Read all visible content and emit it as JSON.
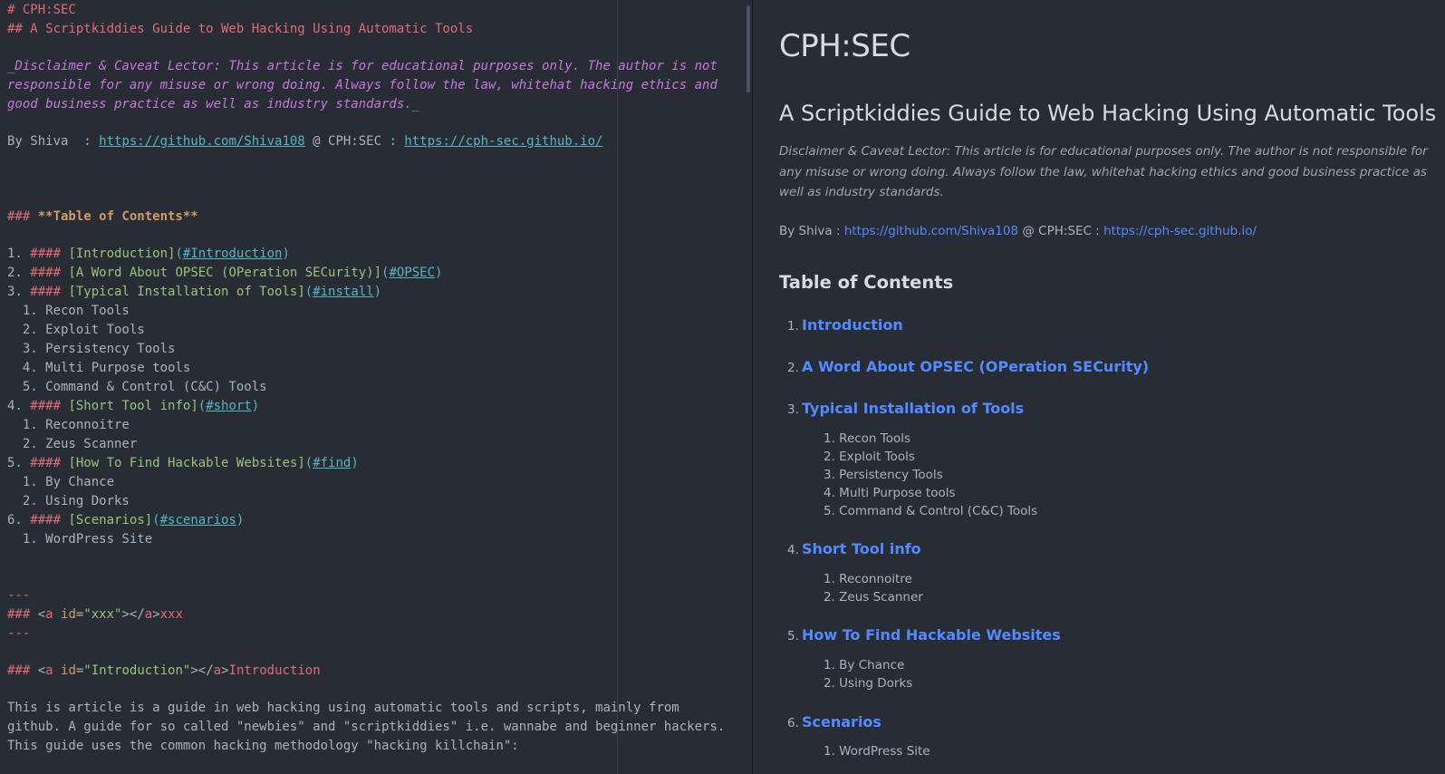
{
  "editor": {
    "h1": "# CPH:SEC",
    "h2": "## A Scriptkiddies Guide to Web Hacking Using Automatic Tools",
    "disclaimer_lines": [
      "_Disclaimer & Caveat Lector: This article is for educational purposes only. The author is not",
      "responsible for any misuse or wrong doing. Always follow the law, whitehat hacking ethics and",
      "good business practice as well as industry standards._"
    ],
    "by_prefix": "By Shiva  : ",
    "github_url": "https://github.com/Shiva108",
    "by_middle": " @ CPH:SEC : ",
    "site_url": "https://cph-sec.github.io/",
    "toc_hash": "### ",
    "toc_title": "**Table of Contents**",
    "toc": [
      {
        "num": "1. ",
        "hash": "####",
        "text": "[Introduction]",
        "anchor": "#Introduction"
      },
      {
        "num": "2. ",
        "hash": "####",
        "text": "[A Word About OPSEC (OPeration SECurity)]",
        "anchor": "#OPSEC"
      },
      {
        "num": "3. ",
        "hash": "####",
        "text": "[Typical Installation of Tools]",
        "anchor": "#install"
      },
      {
        "num": "4. ",
        "hash": "####",
        "text": "[Short Tool info]",
        "anchor": "#short"
      },
      {
        "num": "5. ",
        "hash": "####",
        "text": "[How To Find Hackable Websites]",
        "anchor": "#find"
      },
      {
        "num": "6. ",
        "hash": "####",
        "text": "[Scenarios]",
        "anchor": "#scenarios"
      }
    ],
    "sub_install": [
      "  1. Recon Tools",
      "  2. Exploit Tools",
      "  3. Persistency Tools",
      "  4. Multi Purpose tools",
      "  5. Command & Control (C&C) Tools"
    ],
    "sub_short": [
      "  1. Reconnoitre",
      "  2. Zeus Scanner"
    ],
    "sub_find": [
      "  1. By Chance",
      "  2. Using Dorks"
    ],
    "sub_scen": [
      "  1. WordPress Site"
    ],
    "hr": "---",
    "anchor1_hash": "### ",
    "anchor1_tag_open": "<",
    "anchor1_tag_name": "a",
    "anchor1_attr": " id",
    "anchor1_eq": "=",
    "anchor1_val": "\"xxx\"",
    "anchor1_close": "></",
    "anchor1_tag_name2": "a",
    "anchor1_end": ">",
    "anchor1_text": "xxx",
    "anchor2_val": "\"Introduction\"",
    "anchor2_text": "Introduction",
    "intro_lines": [
      "This is article is a guide in web hacking using automatic tools and scripts, mainly from",
      "github. A guide for so called \"newbies\" and \"scriptkiddies\" i.e. wannabe and beginner hackers.",
      "This guide uses the common hacking methodology \"hacking killchain\":"
    ]
  },
  "preview": {
    "h1": "CPH:SEC",
    "h2": "A Scriptkiddies Guide to Web Hacking Using Automatic Tools",
    "disclaimer": "Disclaimer & Caveat Lector: This article is for educational purposes only. The author is not responsible for any misuse or wrong doing. Always follow the law, whitehat hacking ethics and good business practice as well as industry standards.",
    "by_prefix": "By Shiva : ",
    "github_url": "https://github.com/Shiva108",
    "by_middle": " @ CPH:SEC : ",
    "site_url": "https://cph-sec.github.io/",
    "toc_title": "Table of Contents",
    "toc": [
      {
        "num": "1.",
        "label": "Introduction"
      },
      {
        "num": "2.",
        "label": "A Word About OPSEC (OPeration SECurity)"
      },
      {
        "num": "3.",
        "label": "Typical Installation of Tools"
      },
      {
        "num": "4.",
        "label": "Short Tool info"
      },
      {
        "num": "5.",
        "label": "How To Find Hackable Websites"
      },
      {
        "num": "6.",
        "label": "Scenarios"
      }
    ],
    "sub_install": [
      "1. Recon Tools",
      "2. Exploit Tools",
      "3. Persistency Tools",
      "4. Multi Purpose tools",
      "5. Command & Control (C&C) Tools"
    ],
    "sub_short": [
      "1. Reconnoitre",
      "2. Zeus Scanner"
    ],
    "sub_find": [
      "1. By Chance",
      "2. Using Dorks"
    ],
    "sub_scen": [
      "1. WordPress Site"
    ]
  }
}
